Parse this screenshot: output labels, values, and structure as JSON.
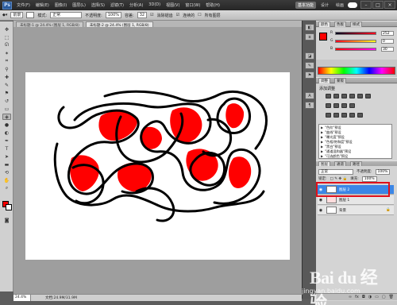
{
  "menubar": {
    "logo": "Ps",
    "menus": [
      "文件(F)",
      "编辑(E)",
      "图像(I)",
      "图层(L)",
      "选择(S)",
      "滤镜(T)",
      "分析(A)",
      "3D(D)",
      "视图(V)",
      "窗口(W)",
      "帮助(H)"
    ],
    "workspace": {
      "active": "基本功能",
      "other1": "设计",
      "other2": "绘画"
    },
    "zoom": "24.4",
    "window_buttons": {
      "min": "–",
      "max": "□",
      "close": "×"
    }
  },
  "options": {
    "preset": "前景",
    "mode_label": "模式:",
    "mode_value": "正常",
    "opacity_label": "不透明度:",
    "opacity_value": "100%",
    "tolerance_label": "容差:",
    "tolerance_value": "32",
    "antialias": "消除锯齿",
    "contiguous": "连续的",
    "all_layers": "所有图层"
  },
  "document": {
    "tab1": "未标题-1 @ 24.4% (图层 1, RGB/8)",
    "tab2": "未标题-2 @ 24.4% (图层 1, RGB/8)",
    "zoom": "24.4%",
    "info": "文档:24.9M/31.9M"
  },
  "color_panel": {
    "tabs": [
      "颜色",
      "色板",
      "样式"
    ],
    "r_label": "R",
    "g_label": "G",
    "b_label": "B",
    "r": "252",
    "g": "0",
    "b": "30",
    "foreground": "#ff0000"
  },
  "adjust_panel": {
    "tabs": [
      "调整",
      "蒙版"
    ],
    "title": "添加调整",
    "presets": [
      "\"色阶\"预设",
      "\"曲线\"预设",
      "\"曝光度\"预设",
      "\"色相/饱和度\"预设",
      "\"黑白\"预设",
      "\"通道混和器\"预设",
      "\"可选颜色\"预设"
    ]
  },
  "layers_panel": {
    "tabs": [
      "图层",
      "通道",
      "路径"
    ],
    "blend_mode": "正常",
    "opacity_label": "不透明度:",
    "opacity": "100%",
    "lock_label": "锁定:",
    "fill_label": "填充:",
    "fill": "100%",
    "layers": [
      {
        "name": "图层 2",
        "selected": true
      },
      {
        "name": "图层 1",
        "selected": false
      },
      {
        "name": "背景",
        "selected": false
      }
    ]
  },
  "watermark": {
    "brand": "Bai du 经验",
    "url": "jingyan.baidu.com"
  },
  "colors": {
    "accent_red": "#ff0000",
    "selection_blue": "#3b86e6",
    "highlight_box": "#e0101a"
  }
}
